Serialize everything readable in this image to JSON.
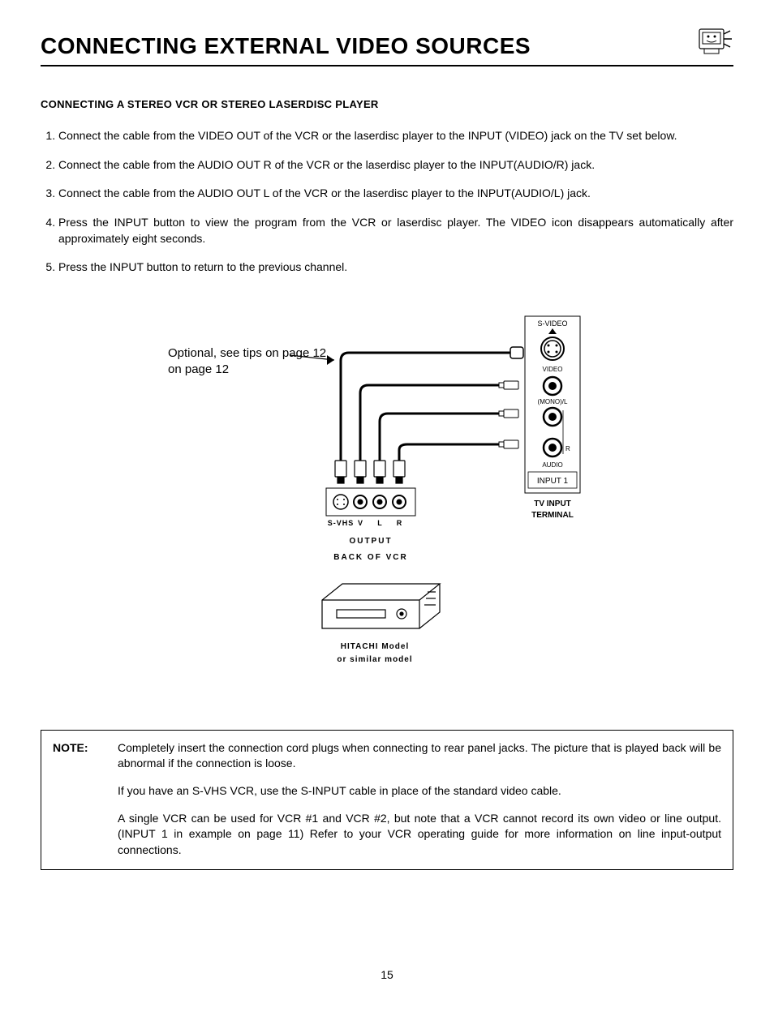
{
  "header": {
    "title": "CONNECTING EXTERNAL VIDEO SOURCES"
  },
  "section": {
    "subtitle": "CONNECTING A STEREO VCR OR STEREO LASERDISC PLAYER"
  },
  "steps": [
    "Connect the cable from the VIDEO OUT of the VCR or the laserdisc player to the INPUT (VIDEO) jack on the TV set below.",
    "Connect the cable from the AUDIO OUT R of the VCR or the laserdisc player to the INPUT(AUDIO/R) jack.",
    "Connect the cable from the AUDIO OUT L of the VCR or the laserdisc player to the INPUT(AUDIO/L) jack.",
    "Press the INPUT button to view the program from the VCR or laserdisc player.  The VIDEO icon disappears automatically after approximately eight seconds.",
    "Press the INPUT button to return to the previous channel."
  ],
  "diagram": {
    "tip_label": "Optional, see tips on page 12",
    "tv_input": {
      "svideo": "S-VIDEO",
      "video": "VIDEO",
      "mono_l": "(MONO)/L",
      "r": "R",
      "audio": "AUDIO",
      "input1": "INPUT 1",
      "terminal": "TV INPUT TERMINAL"
    },
    "vcr": {
      "svhs": "S-VHS",
      "v": "V",
      "l": "L",
      "r": "R",
      "output": "OUTPUT",
      "back": "BACK OF VCR",
      "model1": "HITACHI Model",
      "model2": "or similar model"
    }
  },
  "note": {
    "label": "NOTE:",
    "p1": "Completely insert the connection cord plugs when connecting to rear panel jacks.  The picture that is played back will be abnormal if the connection is loose.",
    "p2": "If you have an S-VHS VCR, use the S-INPUT cable in place of the standard video cable.",
    "p3": "A single VCR can be used for VCR #1 and VCR #2, but note that a VCR cannot record its own video or line output.  (INPUT 1 in example on page 11)  Refer to your VCR operating guide for more information on line input-output connections."
  },
  "page_number": "15"
}
